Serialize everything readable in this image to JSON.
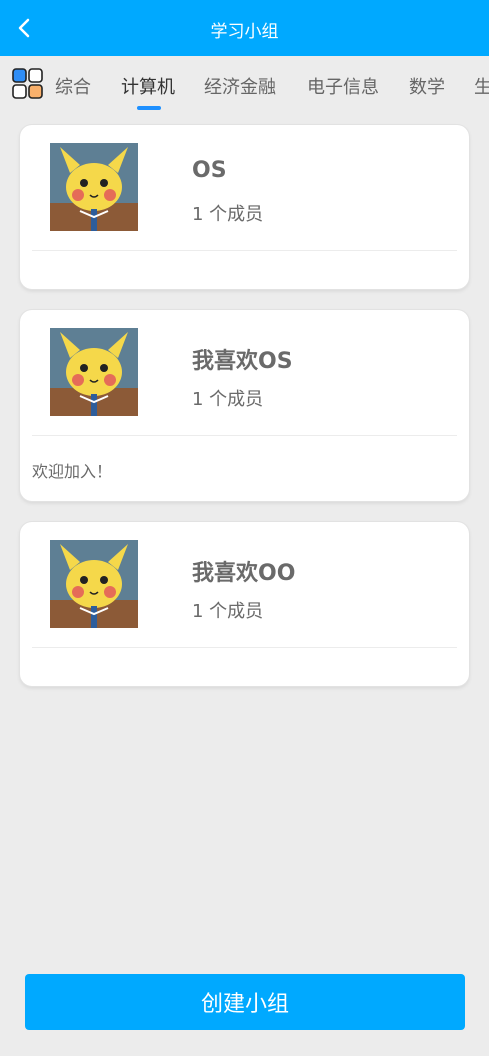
{
  "header": {
    "title": "学习小组"
  },
  "tabs": [
    {
      "label": "综合"
    },
    {
      "label": "计算机"
    },
    {
      "label": "经济金融"
    },
    {
      "label": "电子信息"
    },
    {
      "label": "数学"
    },
    {
      "label": "生"
    }
  ],
  "groups": [
    {
      "name": "OS",
      "members": "1 个成员",
      "description": ""
    },
    {
      "name": "我喜欢OS",
      "members": "1 个成员",
      "description": "欢迎加入！"
    },
    {
      "name": "我喜欢OO",
      "members": "1 个成员",
      "description": ""
    }
  ],
  "footer": {
    "create_label": "创建小组"
  },
  "colors": {
    "accent": "#00a9ff",
    "background": "#ececec",
    "indicator": "#1e90ff"
  },
  "icons": {
    "back": "chevron-left-icon",
    "category": "grid-icon",
    "avatar": "pikachu-avatar"
  }
}
